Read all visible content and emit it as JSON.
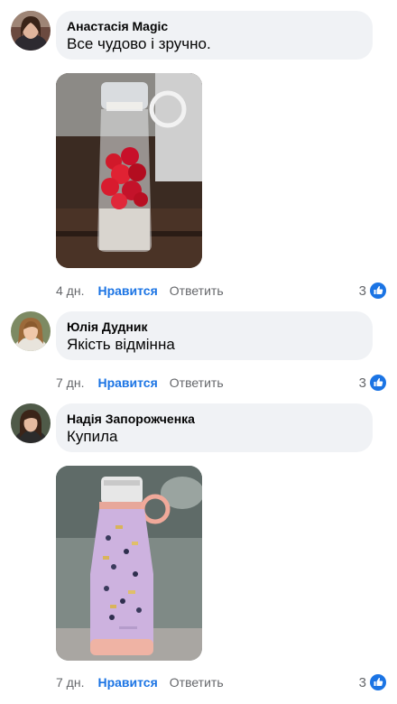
{
  "comments": [
    {
      "author": "Анастасія Magic",
      "text": "Все чудово і зручно.",
      "time": "4 дн.",
      "like_label": "Нравится",
      "reply_label": "Ответить",
      "reaction_count": "3",
      "photo": "jar-strawberries-photo"
    },
    {
      "author": "Юлія Дудник",
      "text": "Якість відмінна",
      "time": "7 дн.",
      "like_label": "Нравится",
      "reply_label": "Ответить",
      "reaction_count": "3"
    },
    {
      "author": "Надія Запорожченка",
      "text": "Купила",
      "time": "7 дн.",
      "like_label": "Нравится",
      "reply_label": "Ответить",
      "reaction_count": "3",
      "photo": "jar-smoothie-photo"
    }
  ],
  "colors": {
    "bubble": "#f0f2f5",
    "like_blue": "#1b74e4",
    "muted": "#65676b"
  }
}
